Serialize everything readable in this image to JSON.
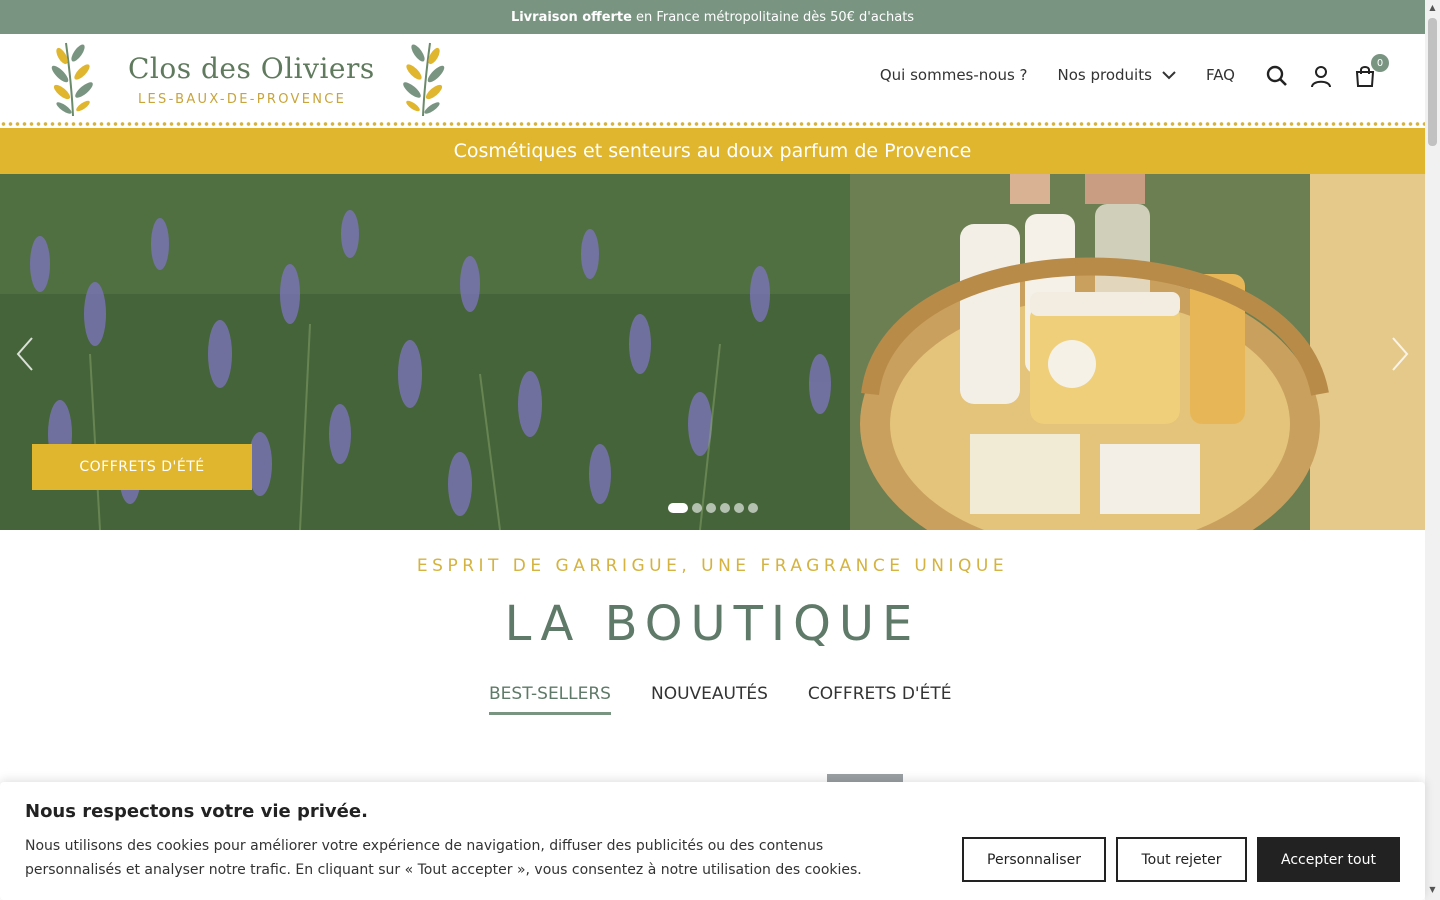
{
  "topbar": {
    "bold": "Livraison offerte",
    "text": "en France métropolitaine dès 50€ d'achats"
  },
  "brand": {
    "name": "Clos des Oliviers",
    "subtitle": "LES-BAUX-DE-PROVENCE"
  },
  "nav": {
    "items": [
      {
        "label": "Qui sommes-nous ?"
      },
      {
        "label": "Nos produits"
      },
      {
        "label": "FAQ"
      }
    ]
  },
  "cart": {
    "count": "0"
  },
  "tagline": "Cosmétiques et senteurs au doux parfum de Provence",
  "hero": {
    "cta": "COFFRETS D'ÉTÉ",
    "slide_count": 6,
    "active_slide": 1
  },
  "shop": {
    "kicker": "ESPRIT DE GARRIGUE, UNE FRAGRANCE UNIQUE",
    "title": "LA BOUTIQUE",
    "tabs": [
      {
        "label": "BEST-SELLERS"
      },
      {
        "label": "NOUVEAUTÉS"
      },
      {
        "label": "COFFRETS D'ÉTÉ"
      }
    ]
  },
  "cookie": {
    "title": "Nous respectons votre vie privée.",
    "text": "Nous utilisons des cookies pour améliorer votre expérience de navigation, diffuser des publicités ou des contenus personnalisés et analyser notre trafic. En cliquant sur « Tout accepter », vous consentez à notre utilisation des cookies.",
    "customize": "Personnaliser",
    "reject": "Tout rejeter",
    "accept": "Accepter tout"
  },
  "colors": {
    "sage": "#7a9482",
    "mustard": "#e0b62f",
    "dark": "#222222"
  }
}
